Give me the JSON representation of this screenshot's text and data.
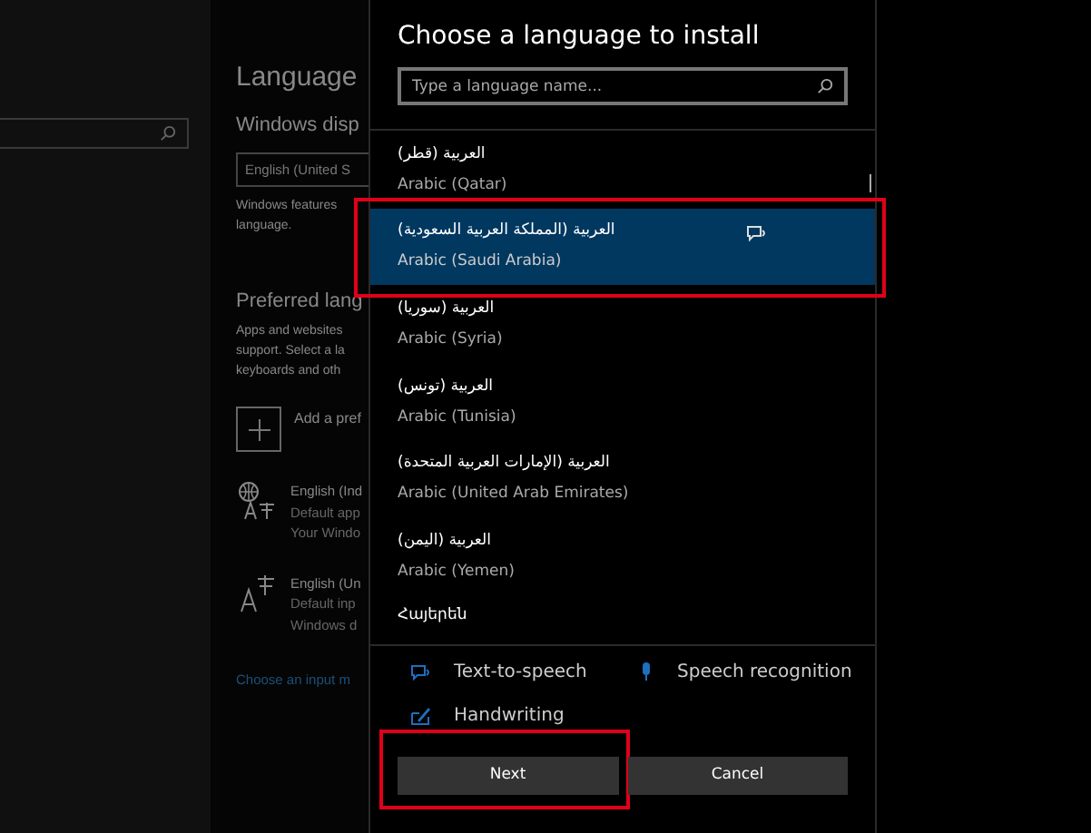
{
  "background": {
    "title": "Language",
    "display_heading": "Windows disp",
    "display_dropdown": "English (United S",
    "display_note": [
      "Windows features",
      "language."
    ],
    "preferred_heading": "Preferred lang",
    "preferred_note": [
      "Apps and websites",
      "support. Select a la",
      "keyboards and oth"
    ],
    "add_label": "Add a pref",
    "languages": [
      {
        "kind": "globe",
        "lines": [
          "English (Ind",
          "Default app",
          "Your Windo"
        ]
      },
      {
        "kind": "keyboard",
        "lines": [
          "English (Un",
          "Default inp",
          "Windows d"
        ]
      }
    ],
    "link": "Choose an input m"
  },
  "dialog": {
    "title": "Choose a language to install",
    "search": {
      "placeholder": "Type a language name..."
    },
    "items": [
      {
        "native": "العربية (قطر)",
        "english": "Arabic (Qatar)",
        "selected": false,
        "highlighted": false
      },
      {
        "native": "العربية (المملكة العربية السعودية)",
        "english": "Arabic (Saudi Arabia)",
        "selected": true,
        "highlighted": true
      },
      {
        "native": "العربية (سوريا)",
        "english": "Arabic (Syria)",
        "selected": false,
        "highlighted": false
      },
      {
        "native": "العربية (تونس)",
        "english": "Arabic (Tunisia)",
        "selected": false,
        "highlighted": false
      },
      {
        "native": "العربية (الإمارات العربية المتحدة)",
        "english": "Arabic (United Arab Emirates)",
        "selected": false,
        "highlighted": false
      },
      {
        "native": "العربية (اليمن)",
        "english": "Arabic (Yemen)",
        "selected": false,
        "highlighted": false
      },
      {
        "native": "Հայերեն",
        "selected": false,
        "highlighted": false
      }
    ],
    "features": [
      {
        "kind": "tts",
        "label": "Text-to-speech"
      },
      {
        "kind": "speech",
        "label": "Speech recognition"
      },
      {
        "kind": "handwriting",
        "label": "Handwriting"
      }
    ],
    "buttons": [
      {
        "label": "Next",
        "highlighted": true
      },
      {
        "label": "Cancel",
        "highlighted": false
      }
    ]
  }
}
